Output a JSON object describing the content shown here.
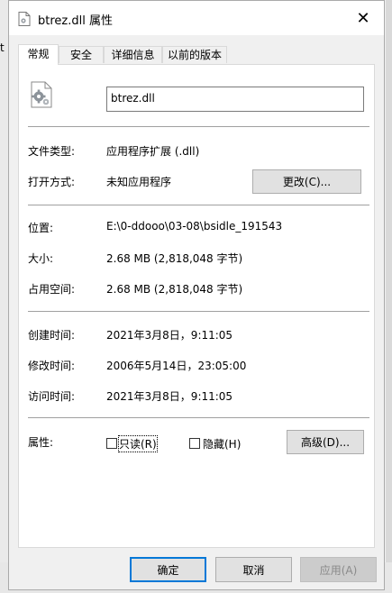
{
  "window": {
    "title": "btrez.dll 属性",
    "close_glyph": "✕"
  },
  "background": {
    "left_char": "t",
    "right_char": "3/"
  },
  "tabs": [
    {
      "label": "常规",
      "active": true
    },
    {
      "label": "安全",
      "active": false
    },
    {
      "label": "详细信息",
      "active": false
    },
    {
      "label": "以前的版本",
      "active": false
    }
  ],
  "general": {
    "file_name": "btrez.dll",
    "file_type_label": "文件类型:",
    "file_type_value": "应用程序扩展 (.dll)",
    "open_with_label": "打开方式:",
    "open_with_value": "未知应用程序",
    "change_button": "更改(C)...",
    "location_label": "位置:",
    "location_value": "E:\\0-ddooo\\03-08\\bsidle_191543",
    "size_label": "大小:",
    "size_value": "2.68 MB (2,818,048 字节)",
    "size_on_disk_label": "占用空间:",
    "size_on_disk_value": "2.68 MB (2,818,048 字节)",
    "created_label": "创建时间:",
    "created_value": "2021年3月8日，9:11:05",
    "modified_label": "修改时间:",
    "modified_value": "2006年5月14日，23:05:00",
    "accessed_label": "访问时间:",
    "accessed_value": "2021年3月8日，9:11:05",
    "attributes_label": "属性:",
    "readonly_label": "只读(R)",
    "readonly_checked": false,
    "hidden_label": "隐藏(H)",
    "hidden_checked": false,
    "advanced_button": "高级(D)..."
  },
  "footer": {
    "ok": "确定",
    "cancel": "取消",
    "apply": "应用(A)"
  },
  "colors": {
    "accent": "#0078d7",
    "separator": "#a0a0a0"
  },
  "icons": {
    "title": "dll-file-icon",
    "big": "dll-file-gear-icon"
  }
}
